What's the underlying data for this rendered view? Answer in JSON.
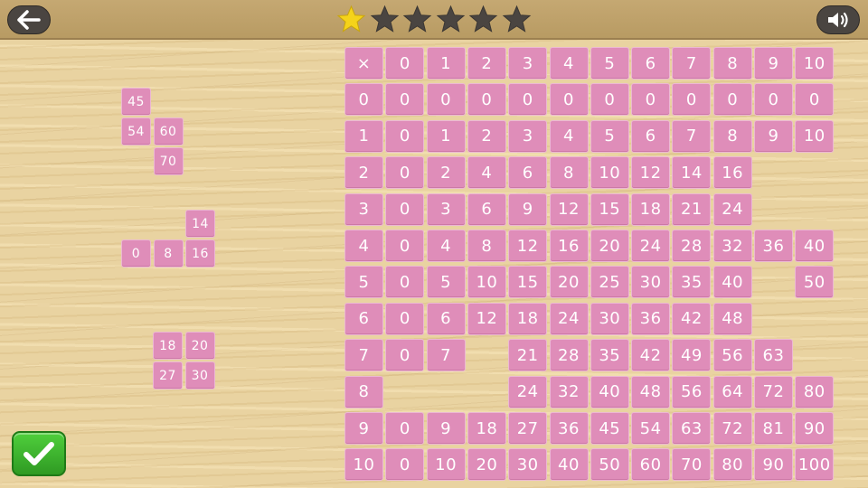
{
  "header": {
    "back_icon": "arrow-left-icon",
    "sound_icon": "speaker-icon",
    "stars_earned": 1,
    "stars_total": 6,
    "star_color_earned": "#f5d31a",
    "star_color_empty": "#4a4541"
  },
  "table": {
    "header_symbol": "×",
    "column_headers": [
      "0",
      "1",
      "2",
      "3",
      "4",
      "5",
      "6",
      "7",
      "8",
      "9",
      "10"
    ],
    "rows": [
      {
        "label": "0",
        "cells": [
          "0",
          "0",
          "0",
          "0",
          "0",
          "0",
          "0",
          "0",
          "0",
          "0",
          "0"
        ]
      },
      {
        "label": "1",
        "cells": [
          "0",
          "1",
          "2",
          "3",
          "4",
          "5",
          "6",
          "7",
          "8",
          "9",
          "10"
        ]
      },
      {
        "label": "2",
        "cells": [
          "0",
          "2",
          "4",
          "6",
          "8",
          "10",
          "12",
          "14",
          "16",
          null,
          null
        ]
      },
      {
        "label": "3",
        "cells": [
          "0",
          "3",
          "6",
          "9",
          "12",
          "15",
          "18",
          "21",
          "24",
          null,
          null
        ]
      },
      {
        "label": "4",
        "cells": [
          "0",
          "4",
          "8",
          "12",
          "16",
          "20",
          "24",
          "28",
          "32",
          "36",
          "40"
        ]
      },
      {
        "label": "5",
        "cells": [
          "0",
          "5",
          "10",
          "15",
          "20",
          "25",
          "30",
          "35",
          "40",
          null,
          "50"
        ]
      },
      {
        "label": "6",
        "cells": [
          "0",
          "6",
          "12",
          "18",
          "24",
          "30",
          "36",
          "42",
          "48",
          null,
          null
        ]
      },
      {
        "label": "7",
        "cells": [
          "0",
          "7",
          null,
          "21",
          "28",
          "35",
          "42",
          "49",
          "56",
          "63",
          null
        ]
      },
      {
        "label": "8",
        "cells": [
          null,
          null,
          null,
          "24",
          "32",
          "40",
          "48",
          "56",
          "64",
          "72",
          "80"
        ]
      },
      {
        "label": "9",
        "cells": [
          "0",
          "9",
          "18",
          "27",
          "36",
          "45",
          "54",
          "63",
          "72",
          "81",
          "90"
        ]
      },
      {
        "label": "10",
        "cells": [
          "0",
          "10",
          "20",
          "30",
          "40",
          "50",
          "60",
          "70",
          "80",
          "90",
          "100"
        ]
      }
    ]
  },
  "pieces": [
    {
      "name": "piece-a",
      "cells": [
        {
          "value": "45",
          "col": 0,
          "row": 0
        },
        {
          "value": "54",
          "col": 0,
          "row": 1
        },
        {
          "value": "60",
          "col": 1,
          "row": 1
        },
        {
          "value": "70",
          "col": 1,
          "row": 2
        }
      ]
    },
    {
      "name": "piece-b",
      "cells": [
        {
          "value": "14",
          "col": 2,
          "row": 0
        },
        {
          "value": "0",
          "col": 0,
          "row": 1
        },
        {
          "value": "8",
          "col": 1,
          "row": 1
        },
        {
          "value": "16",
          "col": 2,
          "row": 1
        }
      ]
    },
    {
      "name": "piece-c",
      "cells": [
        {
          "value": "18",
          "col": 0,
          "row": 0
        },
        {
          "value": "20",
          "col": 1,
          "row": 0
        },
        {
          "value": "27",
          "col": 0,
          "row": 1
        },
        {
          "value": "30",
          "col": 1,
          "row": 1
        }
      ]
    }
  ],
  "footer": {
    "check_icon": "checkmark-icon"
  }
}
